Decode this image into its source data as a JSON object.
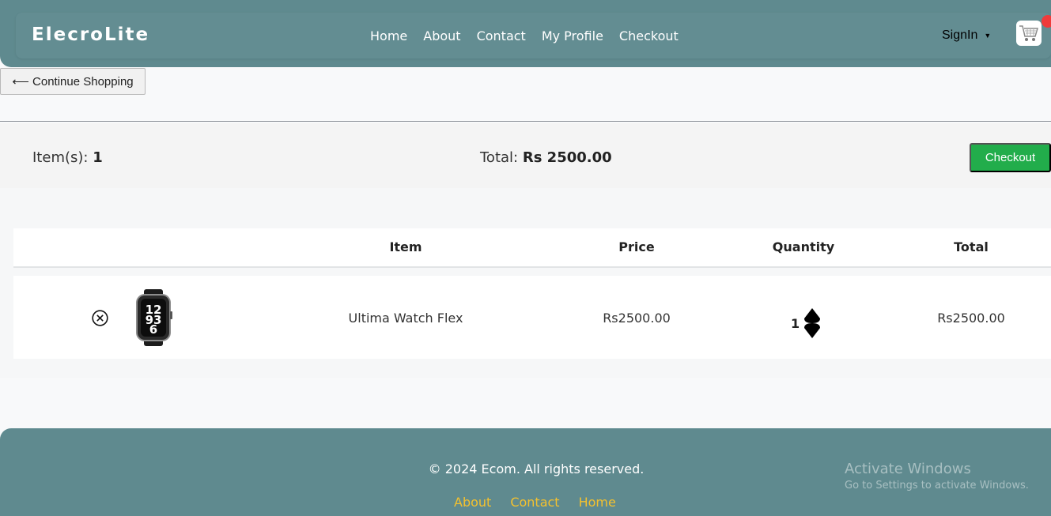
{
  "brand": "ElecroLite",
  "nav": [
    "Home",
    "About",
    "Contact",
    "My Profile",
    "Checkout"
  ],
  "signin": "SignIn",
  "continue_shopping": "⟵ Continue Shopping",
  "summary": {
    "items_label": "Item(s):",
    "items_count": "1",
    "total_label": "Total:",
    "total_value": "Rs 2500.00",
    "checkout_label": "Checkout"
  },
  "table": {
    "headers": [
      "Item",
      "Price",
      "Quantity",
      "Total"
    ],
    "rows": [
      {
        "name": "Ultima Watch Flex",
        "price": "Rs2500.00",
        "quantity": "1",
        "total": "Rs2500.00"
      }
    ]
  },
  "footer": {
    "copyright": "© 2024 Ecom. All rights reserved.",
    "links": [
      "About",
      "Contact",
      "Home"
    ]
  },
  "watermark": {
    "title": "Activate Windows",
    "subtitle": "Go to Settings to activate Windows."
  },
  "colors": {
    "navbar": "#5f8a8f",
    "checkout": "#22ad4b",
    "footer_link": "#f4c12e",
    "cart_badge": "#ef3b3b"
  },
  "icons": [
    "cart-icon",
    "caret-down-icon",
    "remove-circle-icon",
    "stepper-up-icon",
    "stepper-down-icon"
  ]
}
